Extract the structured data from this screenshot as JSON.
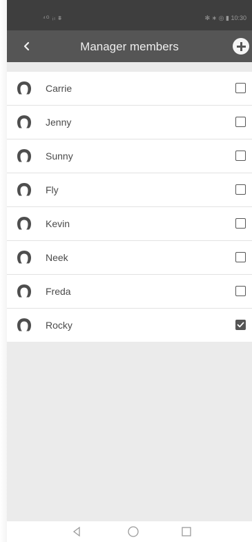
{
  "status_bar": {
    "left_icons": "⁴ᴳ ᵢₗ ⩩",
    "right_text": "✻ ∗ ◎ ▮ 10:30"
  },
  "app_bar": {
    "title": "Manager members",
    "back_icon": "chevron-left-icon",
    "add_icon": "plus-circle-icon"
  },
  "members": [
    {
      "name": "Carrie",
      "checked": false
    },
    {
      "name": "Jenny",
      "checked": false
    },
    {
      "name": "Sunny",
      "checked": false
    },
    {
      "name": "Fly",
      "checked": false
    },
    {
      "name": "Kevin",
      "checked": false
    },
    {
      "name": "Neek",
      "checked": false
    },
    {
      "name": "Freda",
      "checked": false
    },
    {
      "name": "Rocky",
      "checked": true
    }
  ],
  "nav_bar": {
    "icons": [
      "back-triangle-icon",
      "home-circle-icon",
      "recents-square-icon"
    ]
  },
  "colors": {
    "status_bar": "#3e3e3e",
    "app_bar": "#555555",
    "background": "#ebebeb",
    "list_bg": "#ffffff"
  }
}
